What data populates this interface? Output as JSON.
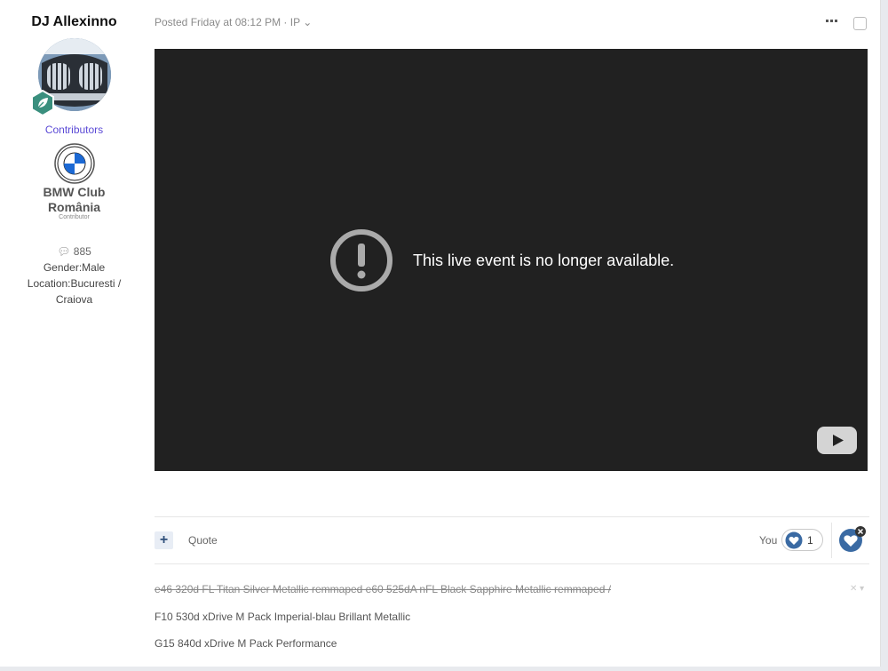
{
  "author": {
    "name": "DJ Allexinno",
    "group": "Contributors",
    "club_name_line1": "BMW Club",
    "club_name_line2": "România",
    "club_sub": "Contributor",
    "post_count": "885",
    "gender": "Gender:Male",
    "location_line1": "Location:Bucuresti /",
    "location_line2": "Craiova"
  },
  "post": {
    "meta": "Posted Friday at 08:12 PM · IP ⌄"
  },
  "video": {
    "message": "This live event is no longer available."
  },
  "actions": {
    "plus_label": "+",
    "quote_label": "Quote",
    "reactors_label": "You",
    "reaction_count": "1"
  },
  "signature": {
    "line1": "e46 320d FL Titan Silver Metallic remmaped e60 525dA nFL Black Sapphire Metallic remmaped /",
    "line2": "F10 530d xDrive M Pack Imperial-blau Brillant Metallic",
    "line3": "G15 840d xDrive M Pack Performance",
    "close_label": "✕ ▾"
  },
  "colors": {
    "group": "#5b4ad6",
    "video_bg": "#212121",
    "reaction_blue": "#3a6aa3"
  }
}
